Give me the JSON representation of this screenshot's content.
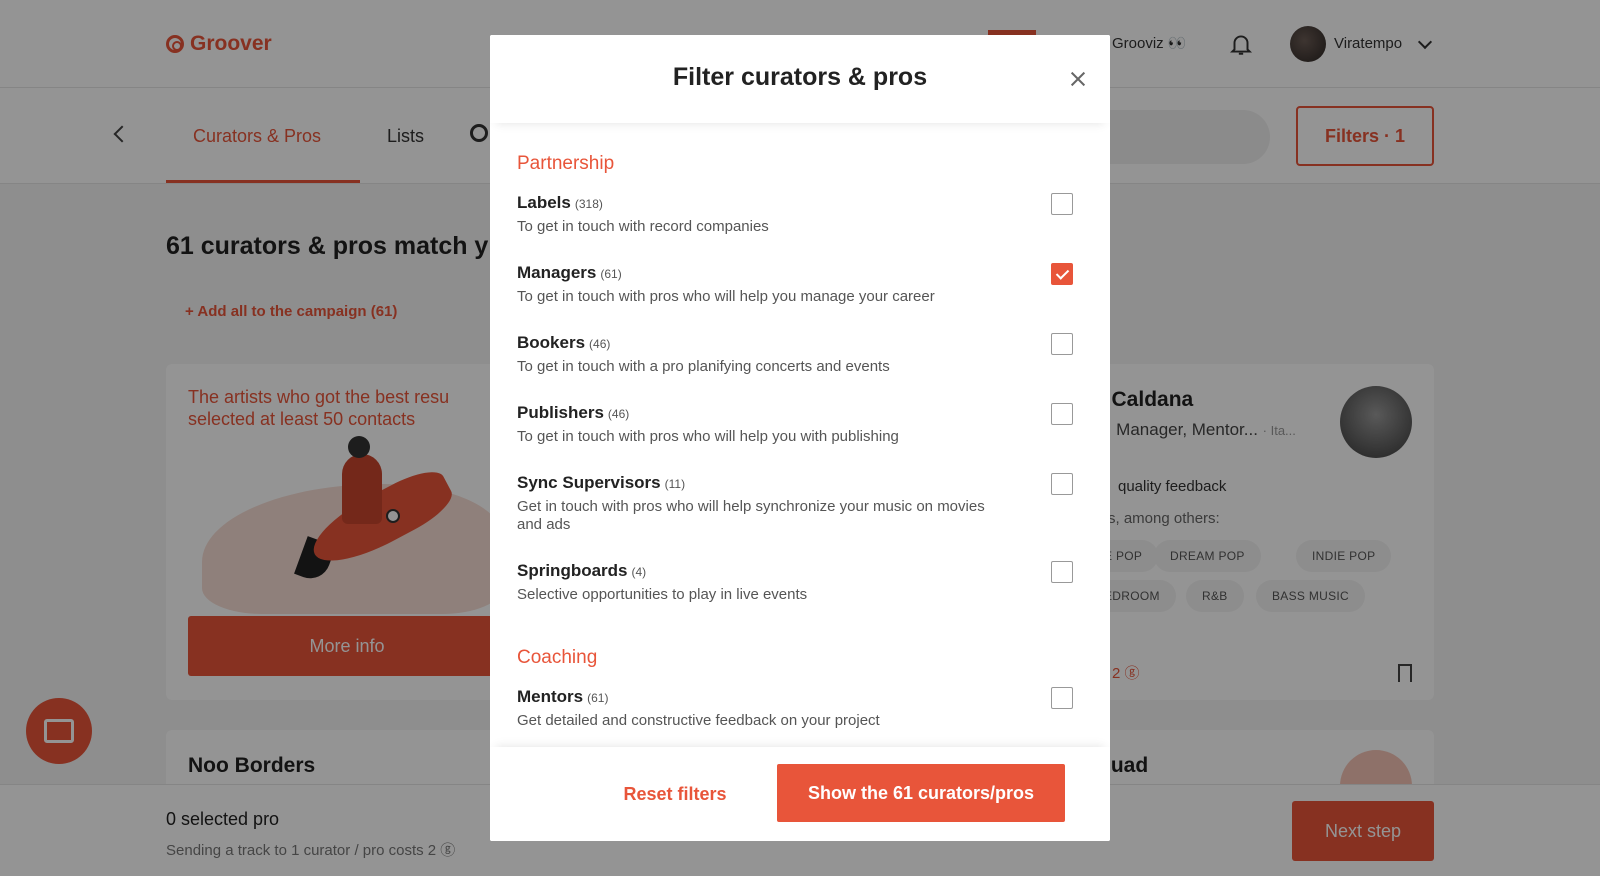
{
  "app": {
    "logo_text": "Groover",
    "accent": "#e8553a"
  },
  "topbar": {
    "grooviz": "Grooviz 👀",
    "user_name": "Viratempo"
  },
  "subnav": {
    "tabs": [
      {
        "label": "Curators & Pros",
        "active": true
      },
      {
        "label": "Lists",
        "active": false
      }
    ],
    "filters_label": "Filters · 1"
  },
  "results": {
    "heading": "61 curators & pros match y",
    "add_all": "+ Add all to the campaign (61)"
  },
  "promo": {
    "text": "The artists who got the best resu selected at least 50 contacts",
    "button": "More info"
  },
  "curator": {
    "name": "e Caldana",
    "role": "r, Manager, Mentor...",
    "location": "· Ita...",
    "quality": "quality feedback",
    "among": "s, among others:",
    "tags": [
      "E POP",
      "DREAM POP",
      "INDIE POP",
      "EDROOM",
      "R&B",
      "BASS MUSIC"
    ],
    "price": "2 ⓖ"
  },
  "row2": {
    "left_name": "Noo Borders",
    "right_name": "quad"
  },
  "bottom": {
    "selected": "0 selected pro",
    "cost": "Sending a track to 1 curator / pro costs 2 ⓖ",
    "next": "Next step"
  },
  "modal": {
    "title": "Filter curators & pros",
    "sections": [
      {
        "title": "Partnership",
        "options": [
          {
            "label": "Labels",
            "count": "(318)",
            "desc": "To get in touch with record companies",
            "checked": false
          },
          {
            "label": "Managers",
            "count": "(61)",
            "desc": "To get in touch with pros who will help you manage your career",
            "checked": true
          },
          {
            "label": "Bookers",
            "count": "(46)",
            "desc": "To get in touch with a pro planifying concerts and events",
            "checked": false
          },
          {
            "label": "Publishers",
            "count": "(46)",
            "desc": "To get in touch with pros who will help you with publishing",
            "checked": false
          },
          {
            "label": "Sync Supervisors",
            "count": "(11)",
            "desc": "Get in touch with pros who will help synchronize your music on movies and ads",
            "checked": false
          },
          {
            "label": "Springboards",
            "count": "(4)",
            "desc": "Selective opportunities to play in live events",
            "checked": false
          }
        ]
      },
      {
        "title": "Coaching",
        "options": [
          {
            "label": "Mentors",
            "count": "(61)",
            "desc": "Get detailed and constructive feedback on your project",
            "checked": false
          }
        ]
      }
    ],
    "reset_label": "Reset filters",
    "show_label": "Show the 61 curators/pros"
  }
}
